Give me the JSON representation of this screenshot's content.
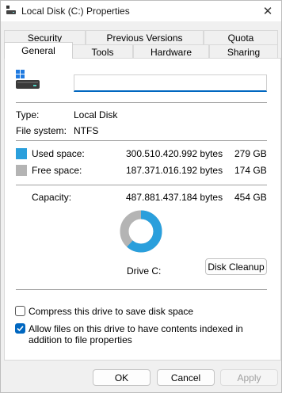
{
  "window": {
    "title": "Local Disk (C:) Properties",
    "close_glyph": "✕"
  },
  "tabs": {
    "row1": [
      {
        "label": "Security"
      },
      {
        "label": "Previous Versions"
      },
      {
        "label": "Quota"
      }
    ],
    "row2": [
      {
        "label": "General",
        "active": true
      },
      {
        "label": "Tools"
      },
      {
        "label": "Hardware"
      },
      {
        "label": "Sharing"
      }
    ]
  },
  "general": {
    "drive_name_value": "",
    "type_label": "Type:",
    "type_value": "Local Disk",
    "fs_label": "File system:",
    "fs_value": "NTFS",
    "used": {
      "label": "Used space:",
      "bytes": "300.510.420.992 bytes",
      "size": "279 GB",
      "color": "#2a9fdc"
    },
    "free": {
      "label": "Free space:",
      "bytes": "187.371.016.192 bytes",
      "size": "174 GB",
      "color": "#b4b4b4"
    },
    "capacity": {
      "label": "Capacity:",
      "bytes": "487.881.437.184 bytes",
      "size": "454 GB"
    },
    "used_fraction": 0.616,
    "drive_label": "Drive C:",
    "cleanup_button": "Disk Cleanup",
    "compress_checkbox": {
      "label": "Compress this drive to save disk space",
      "checked": false
    },
    "index_checkbox": {
      "label": "Allow files on this drive to have contents indexed in addition to file properties",
      "checked": true
    }
  },
  "footer": {
    "ok": "OK",
    "cancel": "Cancel",
    "apply": "Apply"
  },
  "colors": {
    "accent": "#0067c0",
    "used": "#2a9fdc",
    "free": "#b4b4b4"
  }
}
